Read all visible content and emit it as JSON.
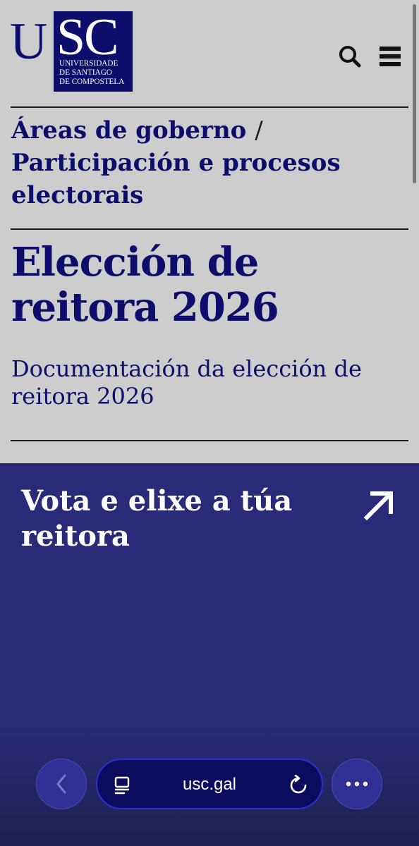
{
  "header": {
    "logo": {
      "letters_u": "U",
      "letters_sc": "SC",
      "subtitle": "UNIVERSIDADE\nDE SANTIAGO\nDE COMPOSTELA"
    },
    "search_icon": "search-icon",
    "menu_icon": "menu-icon"
  },
  "breadcrumb": {
    "items": [
      "Áreas de goberno",
      "Participación e procesos electorais"
    ],
    "separator": "/"
  },
  "page": {
    "title": "Elección de reitora 2026",
    "subtitle": "Documentación da elección de reitora 2026"
  },
  "banner": {
    "title": "Vota e elixe a túa reitora",
    "icon": "arrow-up-right-icon"
  },
  "browser": {
    "url": "usc.gal",
    "back_icon": "chevron-left-icon",
    "reader_icon": "reader-icon",
    "reload_icon": "reload-icon",
    "more_icon": "more-icon"
  },
  "colors": {
    "page_bg": "#cdcdcd",
    "brand_navy": "#0d0d6b",
    "banner_bg": "#2b2a78",
    "url_bar_bg": "#0c0b5e"
  }
}
